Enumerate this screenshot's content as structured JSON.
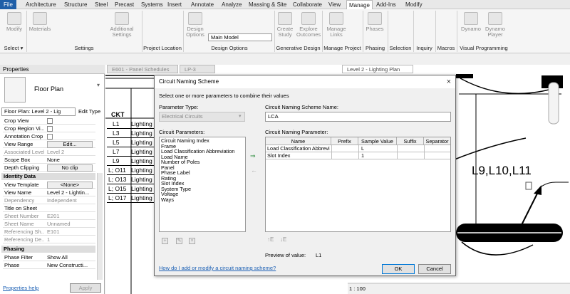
{
  "menubar": {
    "items": [
      "File",
      "Architecture",
      "Structure",
      "Steel",
      "Precast",
      "Systems",
      "Insert",
      "Annotate",
      "Analyze",
      "Massing & Site",
      "Collaborate",
      "View",
      "Manage",
      "Add-Ins",
      "Modify"
    ],
    "active": "Manage"
  },
  "ribbon": {
    "modify": "Modify",
    "materials": "Materials",
    "additional_settings": "Additional Settings",
    "design_options": "Design Options",
    "design_option_select": "Main Model",
    "create_study": "Create Study",
    "explore_outcomes": "Explore Outcomes",
    "manage_links": "Manage Links",
    "phases": "Phases",
    "dynamo": "Dynamo",
    "dynamo_player": "Dynamo Player",
    "panels": {
      "select": "Select ▾",
      "settings": "Settings",
      "project_location": "Project Location",
      "design_options": "Design Options",
      "generative_design": "Generative Design",
      "manage_project": "Manage Project",
      "phasing": "Phasing",
      "selection": "Selection",
      "inquiry": "Inquiry",
      "macros": "Macros",
      "visual_programming": "Visual Programming"
    }
  },
  "properties": {
    "title": "Properties",
    "type_name": "Floor Plan",
    "selector": "Floor Plan: Level 2 - Lig",
    "edit_type": "Edit Type",
    "rows": [
      {
        "k": "Crop View",
        "v": ""
      },
      {
        "k": "Crop Region Vi...",
        "v": ""
      },
      {
        "k": "Annotation Crop",
        "v": ""
      },
      {
        "k": "View Range",
        "v": "Edit..."
      },
      {
        "k": "Associated Level",
        "v": "Level 2"
      },
      {
        "k": "Scope Box",
        "v": "None"
      },
      {
        "k": "Depth Clipping",
        "v": "No clip"
      }
    ],
    "group_identity": "Identity Data",
    "identity_rows": [
      {
        "k": "View Template",
        "v": "<None>"
      },
      {
        "k": "View Name",
        "v": "Level 2 - Lightin..."
      },
      {
        "k": "Dependency",
        "v": "Independent"
      },
      {
        "k": "Title on Sheet",
        "v": ""
      },
      {
        "k": "Sheet Number",
        "v": "E201"
      },
      {
        "k": "Sheet Name",
        "v": "Unnamed"
      },
      {
        "k": "Referencing Sh...",
        "v": "E101"
      },
      {
        "k": "Referencing De...",
        "v": "1"
      }
    ],
    "group_phasing": "Phasing",
    "phasing_rows": [
      {
        "k": "Phase Filter",
        "v": "Show All"
      },
      {
        "k": "Phase",
        "v": "New Constructi..."
      }
    ],
    "help": "Properties help",
    "apply": "Apply"
  },
  "tabs": [
    "E601 - Panel Schedules",
    "LP-3",
    "Level 2 - Lighting Plan"
  ],
  "schedule": {
    "header": "CKT",
    "rows": [
      {
        "c": "L1",
        "d": "Lighting"
      },
      {
        "c": "L3",
        "d": "Lighting"
      },
      {
        "c": "L5",
        "d": "Lighting"
      },
      {
        "c": "L7",
        "d": "Lighting"
      },
      {
        "c": "L9",
        "d": "Lighting"
      },
      {
        "c": "L; O11",
        "d": "Lighting"
      },
      {
        "c": "L; O13",
        "d": "Lighting"
      },
      {
        "c": "L; O15",
        "d": "Lighting"
      },
      {
        "c": "L; O17",
        "d": "Lighting"
      }
    ]
  },
  "plan": {
    "label": "L9,L10,L11",
    "scale": "1 : 100"
  },
  "dialog": {
    "title": "Circuit Naming Scheme",
    "close": "×",
    "instruction": "Select one or more parameters to combine their values",
    "param_type_label": "Parameter Type:",
    "param_type_value": "Electrical Circuits",
    "circuit_params_label": "Circuit Parameters:",
    "params": [
      "Circuit Naming Index",
      "Frame",
      "Load Classification Abbreviation",
      "Load Name",
      "Number of Poles",
      "Panel",
      "Phase Label",
      "Rating",
      "Slot Index",
      "System Type",
      "Voltage",
      "Ways"
    ],
    "scheme_name_label": "Circuit Naming Scheme Name:",
    "scheme_name_value": "LCA",
    "naming_param_label": "Circuit Naming Parameter:",
    "columns": [
      "Name",
      "Prefix",
      "Sample Value",
      "Suffix",
      "Separator"
    ],
    "rows": [
      {
        "name": "Load Classification Abbrevi",
        "prefix": "",
        "sample": "L",
        "suffix": "",
        "separator": ""
      },
      {
        "name": "Slot Index",
        "prefix": "",
        "sample": "1",
        "suffix": "",
        "separator": ""
      }
    ],
    "preview_label": "Preview of value:",
    "preview_value": "L1",
    "help_link": "How do I add or modify a circuit naming scheme?",
    "ok": "OK",
    "cancel": "Cancel"
  }
}
